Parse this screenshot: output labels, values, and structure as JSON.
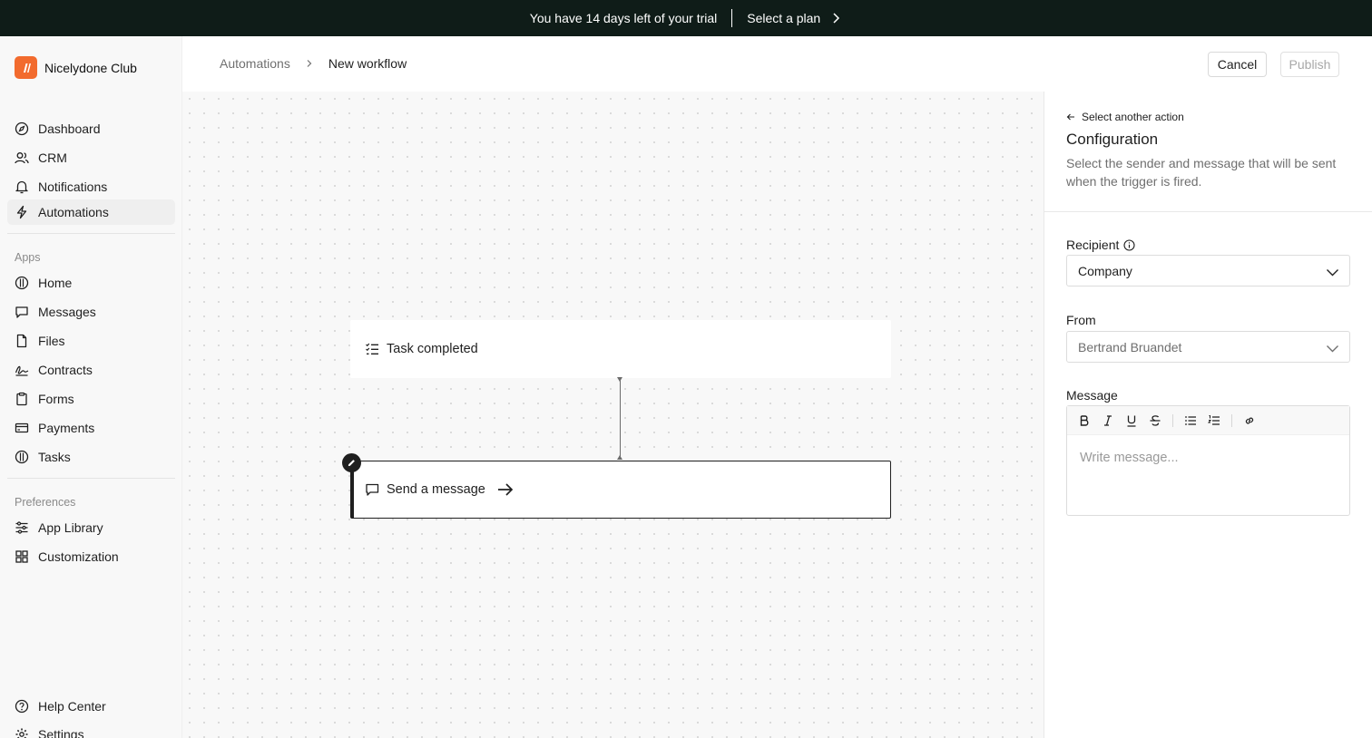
{
  "banner": {
    "message": "You have 14 days left of your trial",
    "plan_link": "Select a plan"
  },
  "brand": {
    "name": "Nicelydone Club",
    "accent": "#f26b2e"
  },
  "sidebar": {
    "main_items": [
      {
        "label": "Dashboard",
        "icon": "compass-icon"
      },
      {
        "label": "CRM",
        "icon": "users-icon"
      },
      {
        "label": "Notifications",
        "icon": "bell-icon"
      },
      {
        "label": "Automations",
        "icon": "bolt-icon",
        "active": true
      }
    ],
    "apps_label": "Apps",
    "apps_items": [
      {
        "label": "Home",
        "icon": "globe-icon"
      },
      {
        "label": "Messages",
        "icon": "chat-icon"
      },
      {
        "label": "Files",
        "icon": "file-icon"
      },
      {
        "label": "Contracts",
        "icon": "signature-icon"
      },
      {
        "label": "Forms",
        "icon": "clipboard-icon"
      },
      {
        "label": "Payments",
        "icon": "card-icon"
      },
      {
        "label": "Tasks",
        "icon": "globe-icon"
      }
    ],
    "preferences_label": "Preferences",
    "pref_items": [
      {
        "label": "App Library",
        "icon": "sliders-icon"
      },
      {
        "label": "Customization",
        "icon": "grid-icon"
      }
    ],
    "bottom_items": [
      {
        "label": "Help Center",
        "icon": "help-icon"
      },
      {
        "label": "Settings",
        "icon": "gear-icon"
      }
    ]
  },
  "topbar": {
    "breadcrumb_root": "Automations",
    "breadcrumb_current": "New workflow",
    "cancel_label": "Cancel",
    "publish_label": "Publish"
  },
  "canvas": {
    "trigger_label": "Task completed",
    "action_label": "Send a message"
  },
  "config": {
    "back_label": "Select another action",
    "title": "Configuration",
    "description": "Select the sender and message that will be sent when the trigger is fired.",
    "recipient_label": "Recipient",
    "recipient_value": "Company",
    "from_label": "From",
    "from_value": "Bertrand Bruandet",
    "message_label": "Message",
    "message_placeholder": "Write message...",
    "toolbar_tools": [
      "bold",
      "italic",
      "underline",
      "strikethrough",
      "bulleted-list",
      "numbered-list",
      "link"
    ]
  }
}
